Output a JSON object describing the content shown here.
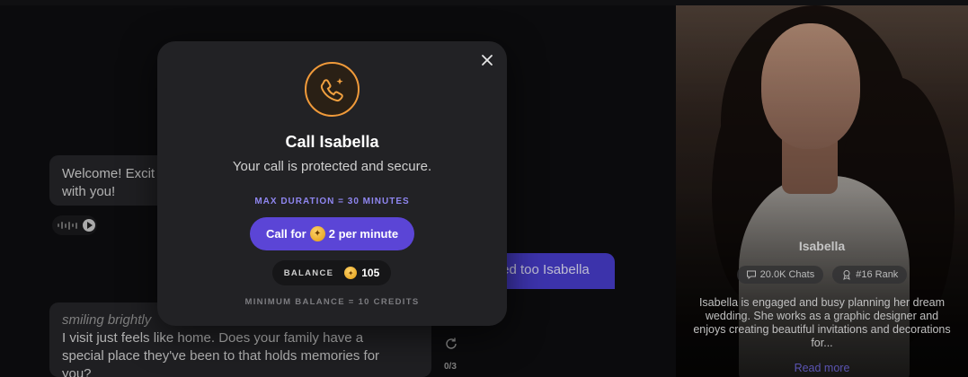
{
  "chat": {
    "bubble1": {
      "line1": "Welcome! Excit",
      "line2": "with you!"
    },
    "sent": {
      "text": "ted too Isabella"
    },
    "bubble2": {
      "italic": "smiling brightly",
      "line1": "I visit just feels like home. Does your family have a",
      "line2": "special place they've been to that holds memories for",
      "line3": "you?"
    },
    "counter": "0/3"
  },
  "profile": {
    "name": "Isabella",
    "chats": "20.0K Chats",
    "rank": "#16 Rank",
    "description": "Isabella is engaged and busy planning her dream wedding. She works as a graphic designer and enjoys creating beautiful invitations and decorations for...",
    "read_more": "Read more"
  },
  "modal": {
    "title": "Call Isabella",
    "subtitle": "Your call is protected and secure.",
    "max_duration": "MAX DURATION = 30 MINUTES",
    "call_prefix": "Call for",
    "call_rate": "2 per minute",
    "balance_label": "BALANCE",
    "balance_value": "105",
    "minimum_balance": "MINIMUM BALANCE = 10 CREDITS"
  },
  "colors": {
    "accent": "#5b45d6",
    "coin": "#f0a21c",
    "icon_ring": "#f09a3a"
  },
  "icons": [
    "close-icon",
    "phone-sparkle-icon",
    "coin-icon",
    "chat-icon",
    "rank-icon",
    "play-icon",
    "waveform-icon",
    "regenerate-icon"
  ]
}
